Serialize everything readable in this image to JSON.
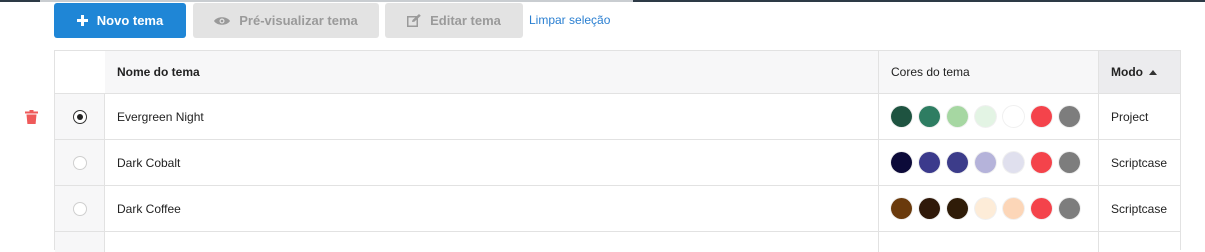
{
  "toolbar": {
    "new_theme_label": "Novo tema",
    "preview_label": "Pré-visualizar tema",
    "edit_label": "Editar tema",
    "clear_selection_label": "Limpar seleção"
  },
  "table": {
    "headers": {
      "name": "Nome do tema",
      "colors": "Cores do tema",
      "mode": "Modo"
    },
    "sort": {
      "column": "mode",
      "direction": "asc"
    },
    "rows": [
      {
        "name": "Evergreen Night",
        "mode": "Project",
        "selected": true,
        "colors": [
          "#1e5340",
          "#2e7d62",
          "#a6d7a2",
          "#e3f4e4",
          "#ffffff",
          "#f4434b",
          "#7d7d7d"
        ]
      },
      {
        "name": "Dark Cobalt",
        "mode": "Scriptcase",
        "selected": false,
        "colors": [
          "#0c0a39",
          "#3b3a8c",
          "#3c3c8a",
          "#b5b3da",
          "#e0e0ee",
          "#f4434b",
          "#7d7d7d"
        ]
      },
      {
        "name": "Dark Coffee",
        "mode": "Scriptcase",
        "selected": false,
        "colors": [
          "#6a3a0c",
          "#30190a",
          "#2f1c08",
          "#fdecd8",
          "#fcd6b8",
          "#f4434b",
          "#7d7d7d"
        ]
      }
    ]
  },
  "colors": {
    "primary": "#1f86d6",
    "danger": "#ef5a5a",
    "link": "#2a7fd1"
  }
}
